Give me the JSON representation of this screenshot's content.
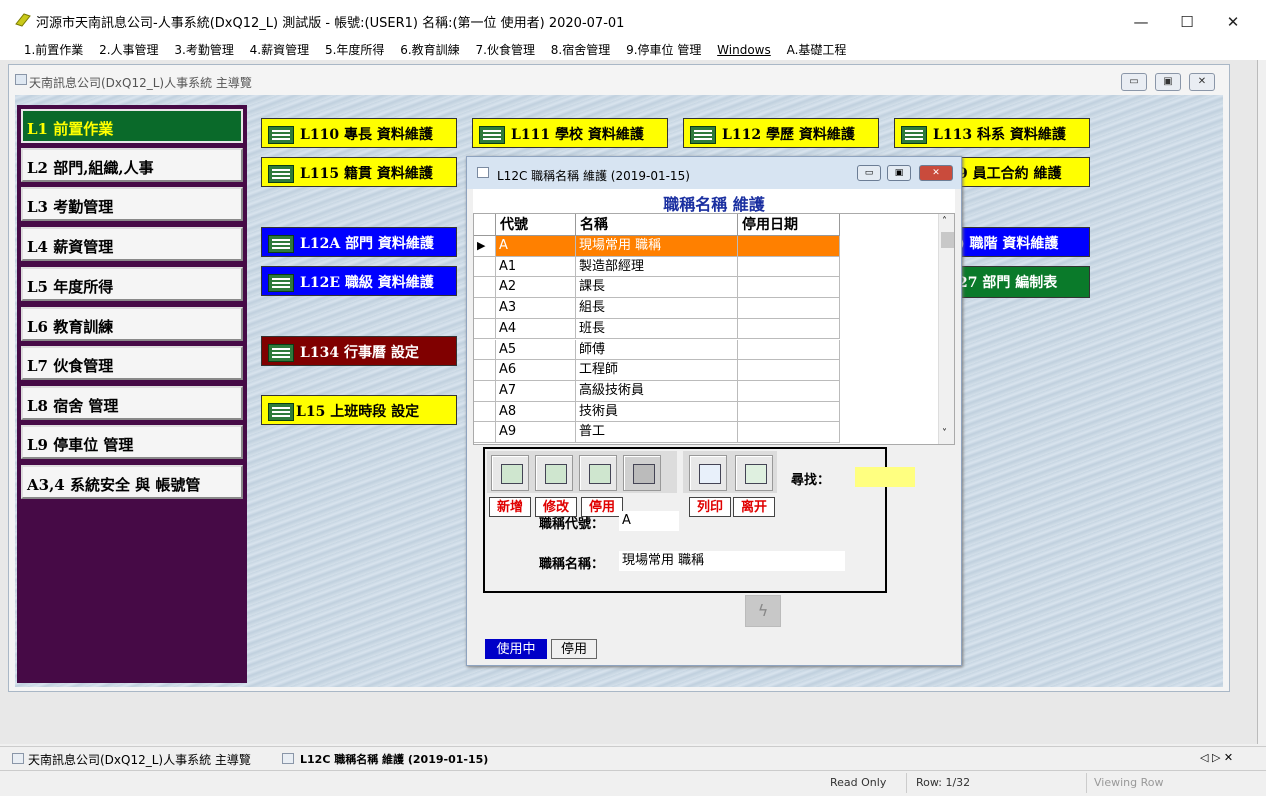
{
  "window": {
    "title": "河源市天南訊息公司-人事系統(DxQ12_L) 測試版 - 帳號:(USER1) 名稱:(第一位 使用者) 2020-07-01",
    "minimize": "—",
    "maximize": "☐",
    "close": "✕"
  },
  "menu": [
    "1.前置作業",
    "2.人事管理",
    "3.考勤管理",
    "4.薪資管理",
    "5.年度所得",
    "6.教育訓練",
    "7.伙食管理",
    "8.宿舍管理",
    "9.停車位 管理",
    "Windows",
    "A.基礎工程"
  ],
  "main_child": {
    "title": "天南訊息公司(DxQ12_L)人事系統 主導覽"
  },
  "sidebar": {
    "items": [
      {
        "label": "L1  前置作業",
        "selected": true
      },
      {
        "label": "L2  部門,組織,人事"
      },
      {
        "label": "L3  考勤管理"
      },
      {
        "label": "L4  薪資管理"
      },
      {
        "label": "L5  年度所得"
      },
      {
        "label": "L6  教育訓練"
      },
      {
        "label": "L7  伙食管理"
      },
      {
        "label": "L8  宿舍  管理"
      },
      {
        "label": "L9  停車位  管理"
      },
      {
        "label": "A3,4  系統安全  與  帳號管"
      }
    ]
  },
  "tiles": {
    "l110": "L110  專長  資料維護",
    "l111": "L111  學校  資料維護",
    "l112": "L112  學歷  資料維護",
    "l113": "L113  科系  資料維護",
    "l115": "L115  籍貫  資料維護",
    "l119": "9  員工合約  維護",
    "l12a": "L12A  部門  資料維護",
    "l12d": ")  職階  資料維護",
    "l12e": "L12E  職級  資料維護",
    "l127": "27  部門  編制表",
    "l134": "L134  行事曆  設定",
    "l15": "L15  上班時段  設定"
  },
  "dialog": {
    "title": "L12C 職稱名稱 維護 (2019-01-15)",
    "heading": "職稱名稱 維護",
    "columns": [
      "代號",
      "名稱",
      "停用日期"
    ],
    "rows": [
      {
        "code": "A",
        "name": "現場常用  職稱",
        "date": ""
      },
      {
        "code": "A1",
        "name": "製造部經理",
        "date": ""
      },
      {
        "code": "A2",
        "name": "課長",
        "date": ""
      },
      {
        "code": "A3",
        "name": "組長",
        "date": ""
      },
      {
        "code": "A4",
        "name": "班長",
        "date": ""
      },
      {
        "code": "A5",
        "name": "師傅",
        "date": ""
      },
      {
        "code": "A6",
        "name": "工程師",
        "date": ""
      },
      {
        "code": "A7",
        "name": "高級技術員",
        "date": ""
      },
      {
        "code": "A8",
        "name": "技術員",
        "date": ""
      },
      {
        "code": "A9",
        "name": "普工",
        "date": ""
      }
    ],
    "row_pointer": "▶",
    "buttons": {
      "add": "新增",
      "edit": "修改",
      "disable": "停用",
      "print": "列印",
      "exit": "离开"
    },
    "search_label": "尋找：",
    "search_value": "",
    "code_label": "職稱代號：",
    "code_value": "A",
    "name_label": "職稱名稱：",
    "name_value": "現場常用  職稱",
    "tabs": [
      "使用中",
      "停用"
    ]
  },
  "taskbar": {
    "item1": "天南訊息公司(DxQ12_L)人事系統 主導覽",
    "item2": "L12C 職稱名稱 維護 (2019-01-15)",
    "nav": "◁  ▷  ✕"
  },
  "status": {
    "mode": "Read Only",
    "row": "Row: 1/32",
    "view": "Viewing Row"
  },
  "colors": {
    "sidebar_bg": "#460a46",
    "selected_row": "#ff8000",
    "tile_yellow": "#ffff00",
    "tile_blue": "#0000ff"
  }
}
